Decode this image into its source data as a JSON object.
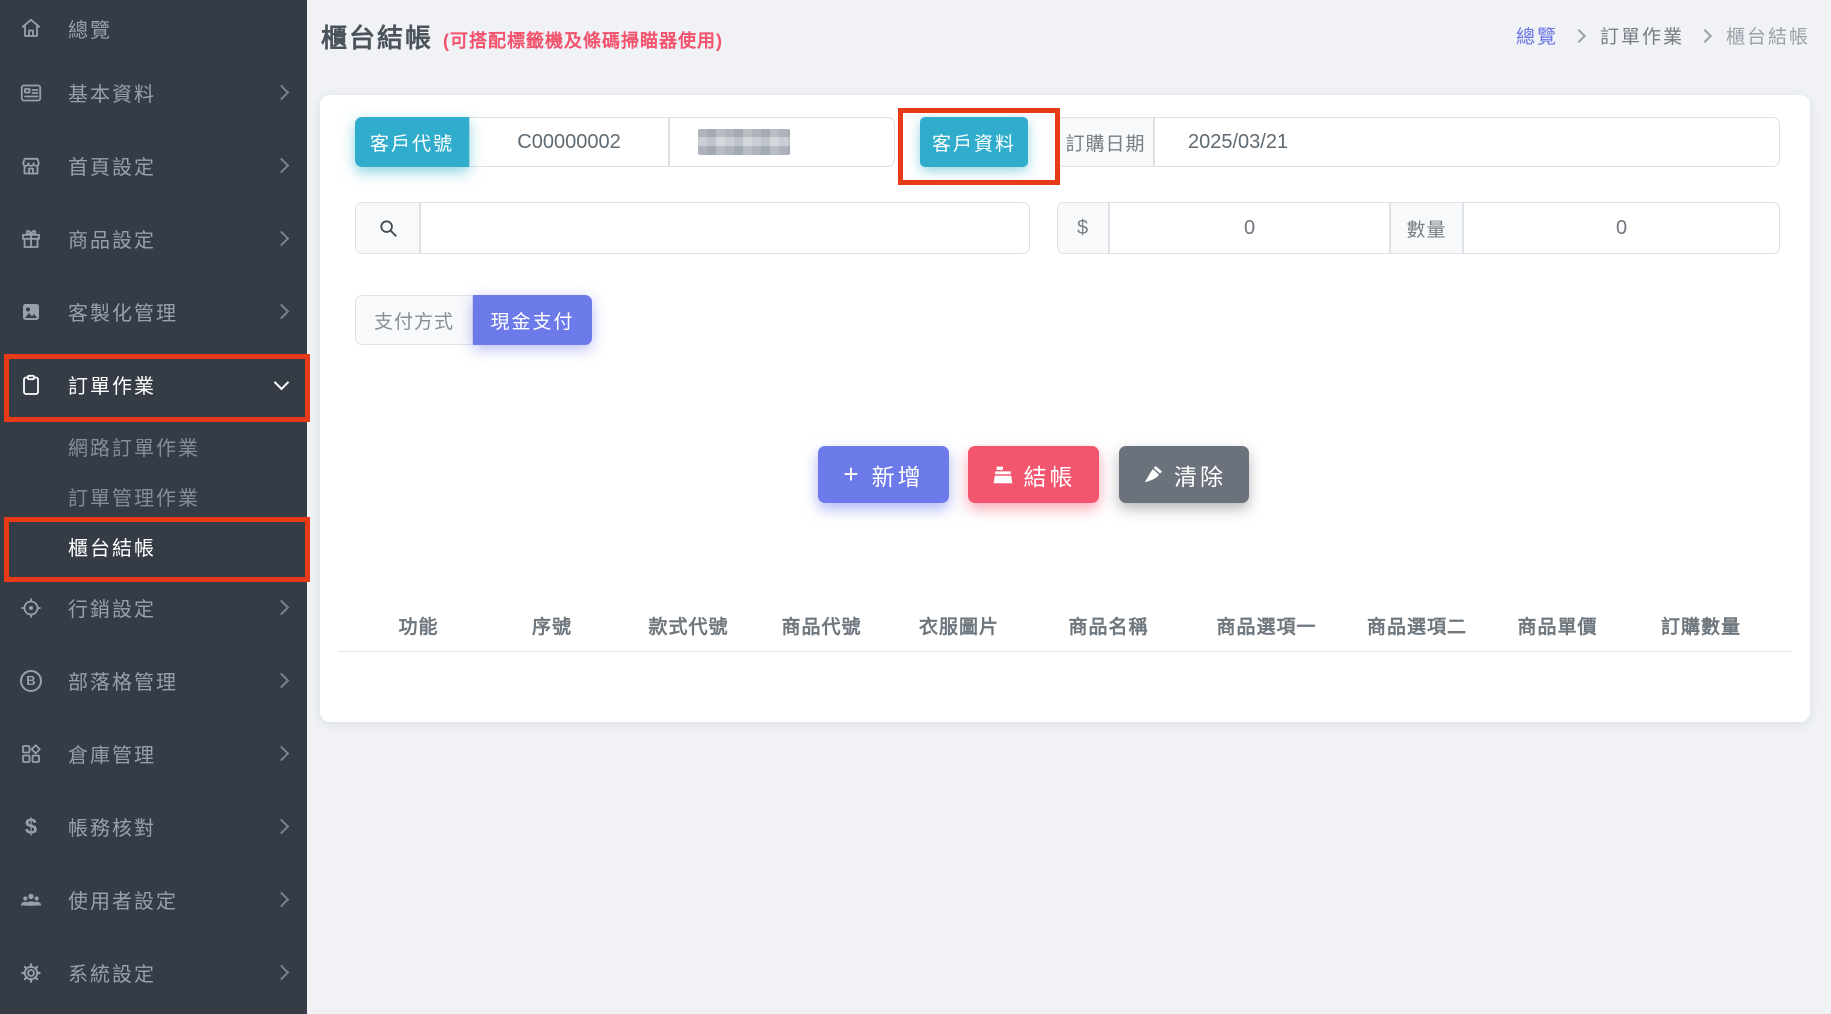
{
  "sidebar": {
    "items": [
      {
        "label": "總覽"
      },
      {
        "label": "基本資料"
      },
      {
        "label": "首頁設定"
      },
      {
        "label": "商品設定"
      },
      {
        "label": "客製化管理"
      },
      {
        "label": "訂單作業",
        "expanded": true
      },
      {
        "label": "網路訂單作業"
      },
      {
        "label": "訂單管理作業"
      },
      {
        "label": "櫃台結帳",
        "active": true
      },
      {
        "label": "行銷設定"
      },
      {
        "label": "部落格管理"
      },
      {
        "label": "倉庫管理"
      },
      {
        "label": "帳務核對"
      },
      {
        "label": "使用者設定"
      },
      {
        "label": "系統設定"
      }
    ]
  },
  "icons": {
    "blog_letter": "B",
    "dollar": "$"
  },
  "header": {
    "title": "櫃台結帳",
    "subtitle": "(可搭配標籤機及條碼掃瞄器使用)"
  },
  "breadcrumb": {
    "overview": "總覽",
    "section": "訂單作業",
    "current": "櫃台結帳"
  },
  "form": {
    "customer_code_label": "客戶代號",
    "customer_code_value": "C00000002",
    "customer_info_button": "客戶資料",
    "order_date_label": "訂購日期",
    "order_date_value": "2025/03/21",
    "search_value": "",
    "amount_label": "$",
    "amount_value": "0",
    "quantity_label": "數量",
    "quantity_value": "0",
    "payment_method_label": "支付方式",
    "payment_method_selected": "現金支付"
  },
  "actions": {
    "add": "新增",
    "checkout": "結帳",
    "clear": "清除"
  },
  "table": {
    "headers": [
      "功能",
      "序號",
      "款式代號",
      "商品代號",
      "衣服圖片",
      "商品名稱",
      "商品選項一",
      "商品選項二",
      "商品單價",
      "訂購數量"
    ]
  },
  "colors": {
    "teal": "#30adcc",
    "indigo": "#6d7ae9",
    "pink": "#f2566f",
    "gray_button": "#6b727b",
    "annotation_red": "#e93a17",
    "sidebar_bg": "#353c46"
  }
}
